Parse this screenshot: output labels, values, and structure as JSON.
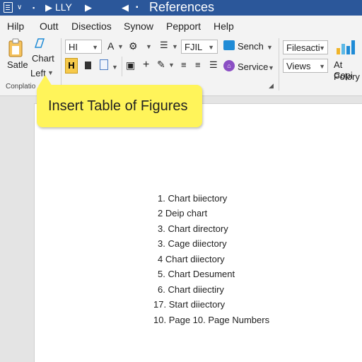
{
  "titlebar": {
    "quick_tokens": [
      "v",
      "LLY",
      "References"
    ],
    "title": "References"
  },
  "menu": [
    "Hilp",
    "Outt",
    "Disectios",
    "Synow",
    "Pepport",
    "Help"
  ],
  "ribbon": {
    "satle": "Satle",
    "chart": "Chart",
    "left": "Left",
    "group_label": "Conplatio",
    "font_box": "HI",
    "style_box": "FJIL",
    "sench": "Sench",
    "service": "Service",
    "filesact": "Filesacti",
    "views": "Views",
    "at_copy": "At Copi",
    "polory": "Polory",
    "h_button": "H"
  },
  "tooltip": "Insert Table of Figures",
  "toc": [
    {
      "num": "1.",
      "text": "Chart biiectory"
    },
    {
      "num": "2",
      "text": "Deip chart"
    },
    {
      "num": "3.",
      "text": "Chart directory"
    },
    {
      "num": "3.",
      "text": "Cage diiectory"
    },
    {
      "num": "4",
      "text": "Chart diiectory"
    },
    {
      "num": "5.",
      "text": "Chart Desument"
    },
    {
      "num": "6.",
      "text": "Chart diiectiry"
    },
    {
      "num": "17.",
      "text": "Start diiectory"
    },
    {
      "num": "10.",
      "text": "Page 10. Page Numbers"
    }
  ],
  "colors": {
    "titlebar": "#2b579a",
    "tooltip": "#fff45a",
    "accent_blue": "#1f8bd6"
  }
}
